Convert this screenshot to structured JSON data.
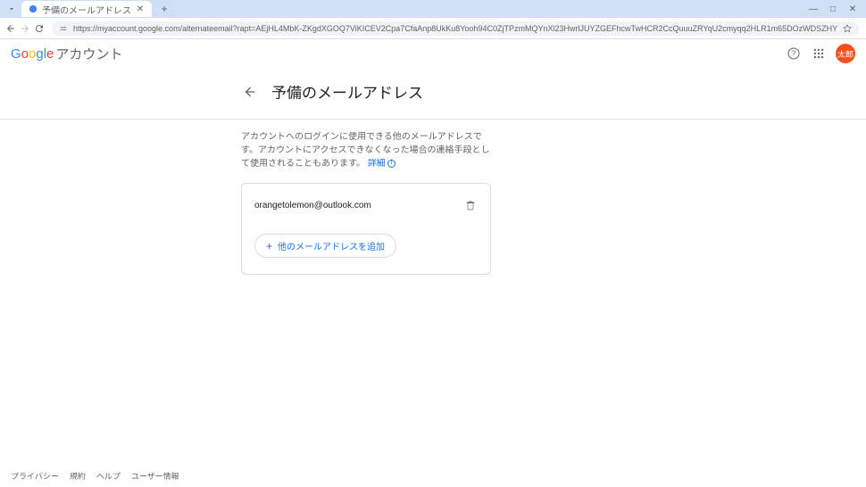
{
  "browser": {
    "tab_title": "予備のメールアドレス",
    "url": "https://myaccount.google.com/alternateemail?rapt=AEjHL4MbK-ZKgdXGOQ7ViKICEV2Cpa7CfaAnp8UkKu8Yooh94C0ZjTPzmMQYnXl23HwrlJUYZGEFhcwTwHCR2CcQuuuZRYqU2cmyqq2HLR1m65DOzWDSZHY"
  },
  "header": {
    "account_label": "アカウント",
    "avatar_text": "太郎"
  },
  "page": {
    "title": "予備のメールアドレス",
    "description": "アカウントへのログインに使用できる他のメールアドレスです。アカウントにアクセスできなくなった場合の連絡手段として使用されることもあります。",
    "detail_link": "詳細"
  },
  "email": {
    "value": "orangetolemon@outlook.com"
  },
  "actions": {
    "add_button": "他のメールアドレスを追加"
  },
  "footer": {
    "privacy": "プライバシー",
    "terms": "規約",
    "help": "ヘルプ",
    "user_info": "ユーザー情報"
  }
}
